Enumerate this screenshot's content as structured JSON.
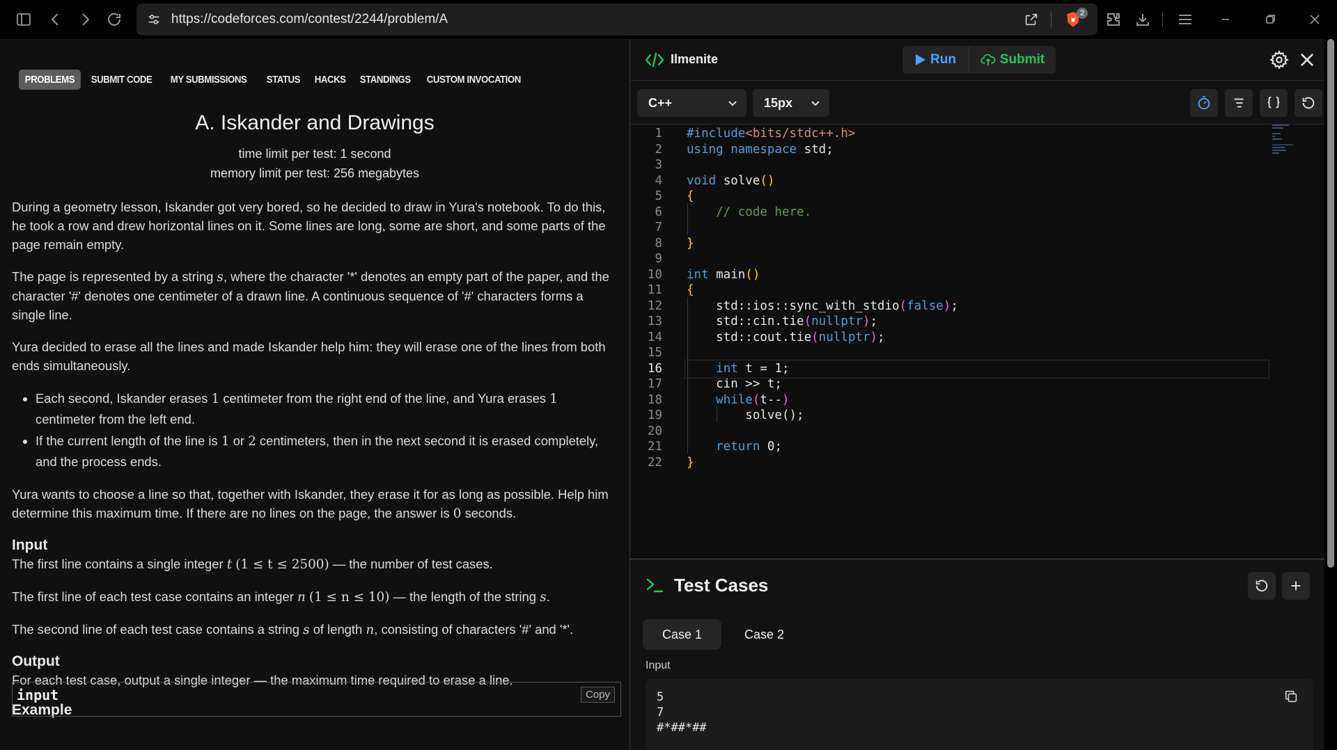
{
  "browser": {
    "url": "https://codeforces.com/contest/2244/problem/A",
    "shield_badge": "2"
  },
  "codeforces": {
    "tabs": [
      "PROBLEMS",
      "SUBMIT CODE",
      "MY SUBMISSIONS",
      "STATUS",
      "HACKS",
      "STANDINGS",
      "CUSTOM INVOCATION"
    ],
    "title": "A. Iskander and Drawings",
    "time_limit": "time limit per test: 1 second",
    "memory_limit": "memory limit per test: 256 megabytes",
    "para1": "During a geometry lesson, Iskander got very bored, so he decided to draw in Yura's notebook. To do this, he took a row and drew horizontal lines on it. Some lines are long, some are short, and some parts of the page remain empty.",
    "para2_a": "The page is represented by a string ",
    "para2_var": "s",
    "para2_b": ", where the character '*' denotes an empty part of the paper, and the character '#' denotes one centimeter of a drawn line. A continuous sequence of '#' characters forms a single line.",
    "para3": "Yura decided to erase all the lines and made Iskander help him: they will erase one of the lines from both ends simultaneously.",
    "bullet1_a": "Each second, Iskander erases ",
    "bullet1_n1": "1",
    "bullet1_b": " centimeter from the right end of the line, and Yura erases ",
    "bullet1_n2": "1",
    "bullet1_c": " centimeter from the left end.",
    "bullet2_a": "If the current length of the line is ",
    "bullet2_n1": "1",
    "bullet2_b": " or ",
    "bullet2_n2": "2",
    "bullet2_c": " centimeters, then in the next second it is erased completely, and the process ends.",
    "para4_a": "Yura wants to choose a line so that, together with Iskander, they erase it for as long as possible. Help him determine this maximum time. If there are no lines on the page, the answer is ",
    "para4_n": "0",
    "para4_b": " seconds.",
    "input_heading": "Input",
    "input1_a": "The first line contains a single integer ",
    "input1_var": "t",
    "input1_math": "(1 ≤ t ≤ 2500)",
    "input1_b": " — the number of test cases.",
    "input2_a": "The first line of each test case contains an integer ",
    "input2_var": "n",
    "input2_math": "(1 ≤ n ≤ 10)",
    "input2_b": " — the length of the string ",
    "input2_var2": "s",
    "input2_c": ".",
    "input3_a": "The second line of each test case contains a string ",
    "input3_var": "s",
    "input3_b": " of length ",
    "input3_var2": "n",
    "input3_c": ", consisting of characters '#' and '*'.",
    "output_heading": "Output",
    "output1": "For each test case, output a single integer — the maximum time required to erase a line.",
    "example_heading": "Example",
    "example_input_label": "input",
    "copy_label": "Copy"
  },
  "ide": {
    "name": "Ilmenite",
    "run_label": "Run",
    "submit_label": "Submit",
    "language": "C++",
    "font_size": "15px",
    "current_line": 16,
    "line_numbers": [
      "1",
      "2",
      "3",
      "4",
      "5",
      "6",
      "7",
      "8",
      "9",
      "10",
      "11",
      "12",
      "13",
      "14",
      "15",
      "16",
      "17",
      "18",
      "19",
      "20",
      "21",
      "22"
    ],
    "code_lines": [
      "#include<bits/stdc++.h>",
      "using namespace std;",
      "",
      "void solve()",
      "{",
      "    // code here.",
      "",
      "}",
      "",
      "int main()",
      "{",
      "    std::ios::sync_with_stdio(false);",
      "    std::cin.tie(nullptr);",
      "    std::cout.tie(nullptr);",
      "",
      "    int t = 1;",
      "    cin >> t;",
      "    while(t--)",
      "        solve();",
      "",
      "    return 0;",
      "}"
    ],
    "tests": {
      "title": "Test Cases",
      "cases": [
        "Case 1",
        "Case 2"
      ],
      "input_label": "Input",
      "input_lines": [
        "5",
        "7",
        "#*##*##"
      ]
    },
    "colors": {
      "accent_green": "#22c55e",
      "accent_blue": "#4aa3ff"
    }
  }
}
